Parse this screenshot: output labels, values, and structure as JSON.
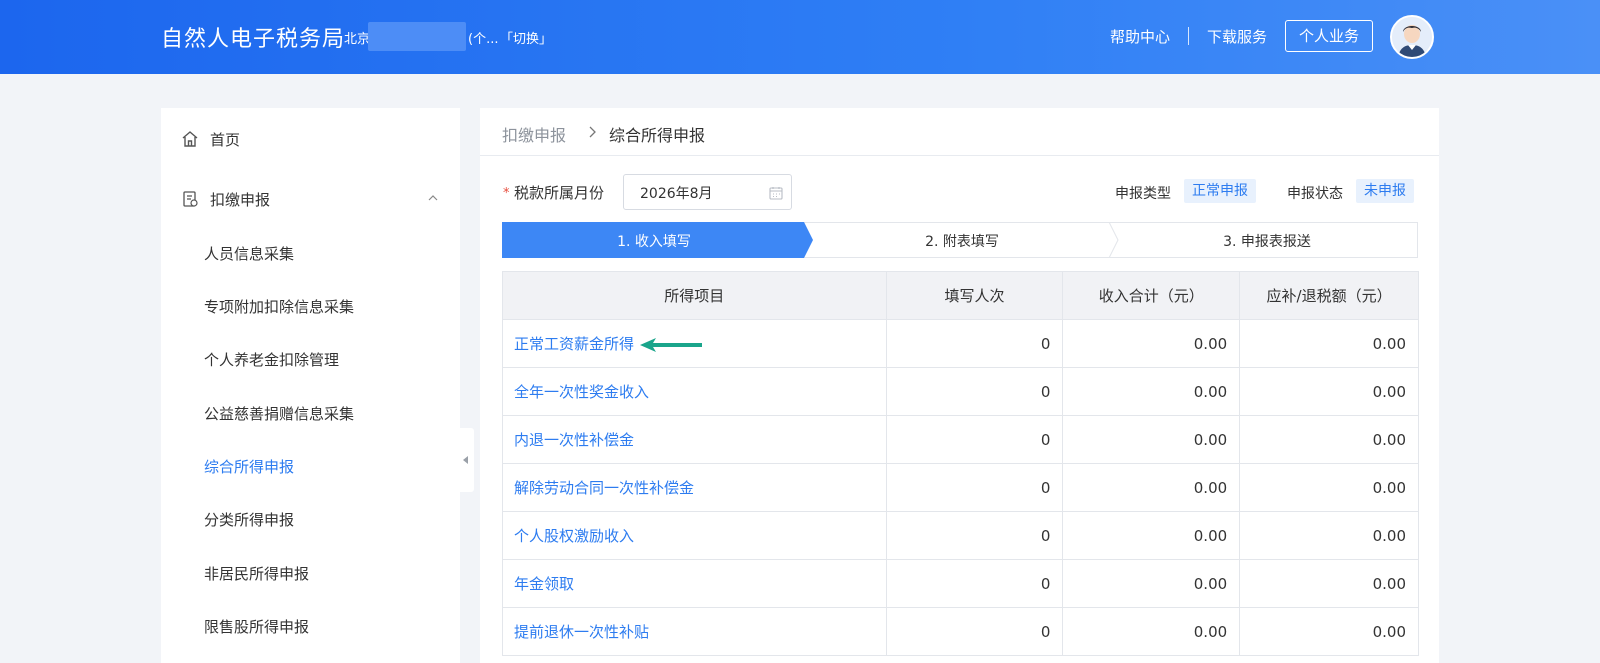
{
  "header": {
    "brand": "自然人电子税务局",
    "region": "北京",
    "region_extra": "(个...",
    "switch_label": "「切换」",
    "help_label": "帮助中心",
    "download_label": "下载服务",
    "personal_label": "个人业务"
  },
  "sidebar": {
    "home_label": "首页",
    "withholding_label": "扣缴申报",
    "items": [
      {
        "label": "人员信息采集"
      },
      {
        "label": "专项附加扣除信息采集"
      },
      {
        "label": "个人养老金扣除管理"
      },
      {
        "label": "公益慈善捐赠信息采集"
      },
      {
        "label": "综合所得申报"
      },
      {
        "label": "分类所得申报"
      },
      {
        "label": "非居民所得申报"
      },
      {
        "label": "限售股所得申报"
      }
    ],
    "active_item": "综合所得申报"
  },
  "breadcrumb": {
    "parent": "扣缴申报",
    "current": "综合所得申报"
  },
  "form": {
    "required_mark": "*",
    "month_label": "税款所属月份",
    "month_value": "2026年8月",
    "type_label": "申报类型",
    "type_value": "正常申报",
    "status_label": "申报状态",
    "status_value": "未申报"
  },
  "steps": [
    {
      "label": "1. 收入填写",
      "active": true
    },
    {
      "label": "2. 附表填写",
      "active": false
    },
    {
      "label": "3. 申报表报送",
      "active": false
    }
  ],
  "table": {
    "headers": [
      "所得项目",
      "填写人次",
      "收入合计（元）",
      "应补/退税额（元）"
    ],
    "rows": [
      {
        "name": "正常工资薪金所得",
        "count": "0",
        "income": "0.00",
        "tax": "0.00"
      },
      {
        "name": "全年一次性奖金收入",
        "count": "0",
        "income": "0.00",
        "tax": "0.00"
      },
      {
        "name": "内退一次性补偿金",
        "count": "0",
        "income": "0.00",
        "tax": "0.00"
      },
      {
        "name": "解除劳动合同一次性补偿金",
        "count": "0",
        "income": "0.00",
        "tax": "0.00"
      },
      {
        "name": "个人股权激励收入",
        "count": "0",
        "income": "0.00",
        "tax": "0.00"
      },
      {
        "name": "年金领取",
        "count": "0",
        "income": "0.00",
        "tax": "0.00"
      },
      {
        "name": "提前退休一次性补贴",
        "count": "0",
        "income": "0.00",
        "tax": "0.00"
      }
    ]
  },
  "colors": {
    "header_start": "#1c66ee",
    "accent": "#2d7cf0",
    "step_active": "#3d87f5",
    "annotation_arrow": "#1aa58b"
  },
  "icons": {
    "home": "home-icon",
    "withholding": "document-icon",
    "calendar": "calendar-icon",
    "annotation": "green-arrow-icon"
  }
}
